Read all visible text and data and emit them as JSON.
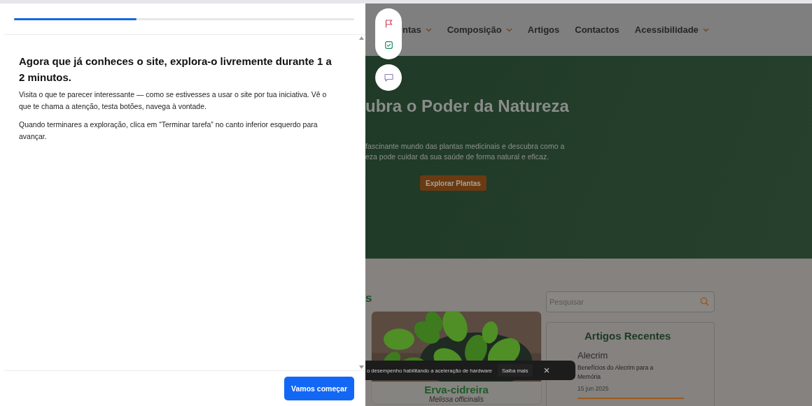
{
  "task_panel": {
    "progress": {
      "level": 0.36
    },
    "heading": "Agora que já conheces o site, explora-o livremente durante 1 a 2 minutos.",
    "paragraphs": [
      "Visita o que te parecer interessante — como se estivesses a usar o site por tua iniciativa. Vê o que te chama a atenção, testa botões, navega à vontade.",
      "Quando terminares a exploração, clica em “Terminar tarefa” no canto inferior esquerdo para avançar."
    ],
    "start_button": "Vamos começar"
  },
  "website": {
    "nav": [
      {
        "label": "ntas",
        "dropdown": true
      },
      {
        "label": "Composição",
        "dropdown": true
      },
      {
        "label": "Artigos",
        "dropdown": false
      },
      {
        "label": "Contactos",
        "dropdown": false
      },
      {
        "label": "Acessibilidade",
        "dropdown": true
      }
    ],
    "hero": {
      "title": "ubra o Poder da Natureza",
      "lines": [
        "fascinante mundo das plantas medicinais e descubra como a",
        "eza pode cuidar da sua saúde de forma natural e eficaz."
      ],
      "button": "Explorar Plantas"
    },
    "section_title": "s",
    "card": {
      "name": "Erva-cidreira",
      "latin": "Melissa officinalis"
    },
    "search": {
      "placeholder": "Pesquisar"
    },
    "recent": {
      "title": "Artigos Recentes",
      "article": {
        "tag": "Alecrim",
        "title": "Benefícios do Alecrim para a Memória",
        "date": "15 jun 2025"
      }
    }
  },
  "toast": {
    "message": "o desempenho habilitando a aceleração de hardware",
    "action": "Saiba mais"
  }
}
